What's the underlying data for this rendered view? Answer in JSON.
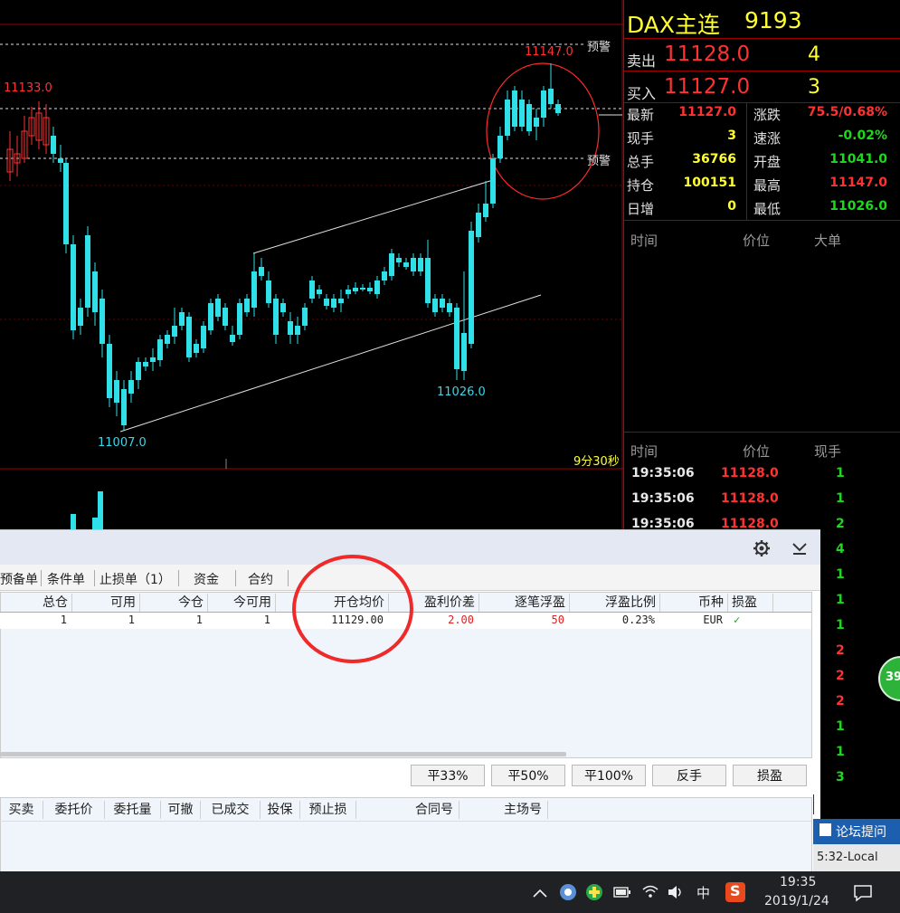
{
  "chart": {
    "labels": {
      "high_left": "11133.0",
      "high_right": "11147.0",
      "low_mid": "11007.0",
      "low_right": "11026.0",
      "alert_top": "预警",
      "alert_mid": "预警",
      "timer": "9分30秒"
    }
  },
  "quote": {
    "title": "DAX主连",
    "code": "9193",
    "ask": {
      "label": "卖出",
      "price": "11128.0",
      "qty": "4"
    },
    "bid": {
      "label": "买入",
      "price": "11127.0",
      "qty": "3"
    },
    "stats": [
      {
        "l1": "最新",
        "v1": "11127.0",
        "l2": "涨跌",
        "v2": "75.5/0.68%"
      },
      {
        "l1": "现手",
        "v1": "3",
        "l2": "速涨",
        "v2": "-0.02%"
      },
      {
        "l1": "总手",
        "v1": "36766",
        "l2": "开盘",
        "v2": "11041.0"
      },
      {
        "l1": "持仓",
        "v1": "100151",
        "l2": "最高",
        "v2": "11147.0"
      },
      {
        "l1": "日增",
        "v1": "0",
        "l2": "最低",
        "v2": "11026.0"
      }
    ],
    "big_header": [
      "时间",
      "价位",
      "大单"
    ],
    "tick_header": [
      "时间",
      "价位",
      "现手"
    ],
    "ticks": [
      {
        "time": "19:35:06",
        "price": "11128.0",
        "qty": "1"
      },
      {
        "time": "19:35:06",
        "price": "11128.0",
        "qty": "1"
      },
      {
        "time": "19:35:06",
        "price": "11128.0",
        "qty": "2"
      }
    ],
    "tick_qtys": [
      {
        "q": "4",
        "c": "green"
      },
      {
        "q": "1",
        "c": "green"
      },
      {
        "q": "1",
        "c": "green"
      },
      {
        "q": "1",
        "c": "green"
      },
      {
        "q": "2",
        "c": "red"
      },
      {
        "q": "2",
        "c": "red"
      },
      {
        "q": "2",
        "c": "red"
      },
      {
        "q": "1",
        "c": "green"
      },
      {
        "q": "1",
        "c": "green"
      },
      {
        "q": "3",
        "c": "green"
      }
    ],
    "badge": "39"
  },
  "trade": {
    "tabs": [
      "预备单",
      "条件单",
      "止损单（1）",
      "资金",
      "合约"
    ],
    "columns": [
      "总仓",
      "可用",
      "今仓",
      "今可用",
      "开仓均价",
      "盈利价差",
      "逐笔浮盈",
      "浮盈比例",
      "币种",
      "损盈"
    ],
    "row": {
      "total": "1",
      "avail": "1",
      "today": "1",
      "today_avail": "1",
      "avg_price": "11129.00",
      "diff": "2.00",
      "pnl": "50",
      "ratio": "0.23%",
      "currency": "EUR",
      "check": "✓"
    },
    "buttons": [
      "平33%",
      "平50%",
      "平100%",
      "反手",
      "损盈"
    ],
    "order_columns": [
      "买卖",
      "委托价",
      "委托量",
      "可撤",
      "已成交",
      "投保",
      "预止损",
      "合同号",
      "主场号"
    ],
    "forum_button": "论坛提问",
    "local_time": "5:32-Local"
  },
  "taskbar": {
    "ime": "中",
    "time": "19:35",
    "date": "2019/1/24"
  }
}
